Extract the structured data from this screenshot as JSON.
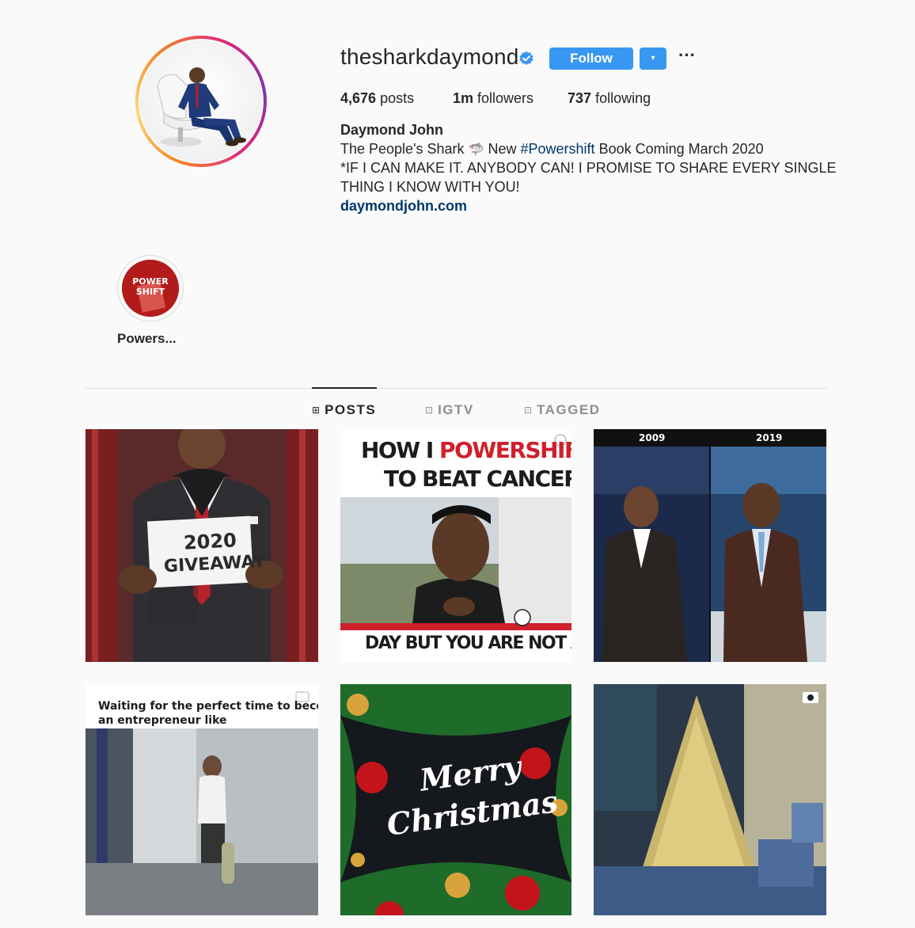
{
  "profile": {
    "username": "thesharkdaymond",
    "follow_label": "Follow",
    "dropdown_icon": "▾",
    "more_icon": "···",
    "stats": {
      "posts_count": "4,676",
      "posts_label": "posts",
      "followers_count": "1m",
      "followers_label": "followers",
      "following_count": "737",
      "following_label": "following"
    },
    "name": "Daymond John",
    "bio_line1_a": "The People's Shark",
    "bio_line1_emoji": "🦈",
    "bio_line1_b": "New",
    "bio_hashtag": "#Powershift",
    "bio_line1_c": "Book Coming March 2020",
    "bio_line2": "*IF I CAN MAKE IT. ANYBODY CAN! I PROMISE TO SHARE EVERY SINGLE",
    "bio_line3": "THING I KNOW WITH YOU!",
    "website": "daymondjohn.com"
  },
  "highlights": [
    {
      "label": "Powers...",
      "cover_line1": "POWER",
      "cover_line2": "SHIFT"
    }
  ],
  "tabs": [
    {
      "label": "POSTS",
      "icon": "⊞",
      "active": true
    },
    {
      "label": "IGTV",
      "icon": "⊡",
      "active": false
    },
    {
      "label": "TAGGED",
      "icon": "⊡",
      "active": false
    }
  ],
  "posts": [
    {
      "type": "image",
      "caption_line1": "2020",
      "caption_line2": "GIVEAWAY"
    },
    {
      "type": "video",
      "caption_top1_a": "HOW I ",
      "caption_top1_b": "POWERSHIFTED",
      "caption_top2": "TO BEAT CANCER",
      "caption_bottom": "DAY BUT YOU ARE NOT ALONE"
    },
    {
      "type": "image",
      "left_year": "2009",
      "right_year": "2019"
    },
    {
      "type": "video",
      "caption_line1": "Waiting for the perfect time to become",
      "caption_line2": "an entrepreneur like"
    },
    {
      "type": "image",
      "caption_line1": "Merry",
      "caption_line2": "Christmas"
    },
    {
      "type": "video"
    }
  ],
  "colors": {
    "follow_blue": "#3897f0",
    "link_blue": "#00376b",
    "verified_blue": "#3897f0",
    "text": "#262626",
    "muted": "#8e8e8e",
    "powershift_red": "#d0202a"
  }
}
